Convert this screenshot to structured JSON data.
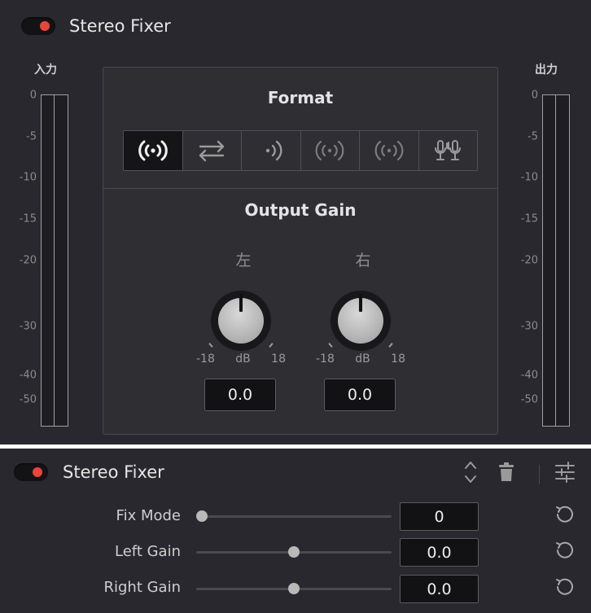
{
  "plugin": {
    "title": "Stereo Fixer",
    "enabled": true,
    "toggle_color": "#e8453c"
  },
  "input_meter": {
    "label": "入力",
    "ticks": [
      "0",
      "-5",
      "-10",
      "-15",
      "-20",
      "-30",
      "-40",
      "-50"
    ]
  },
  "output_meter": {
    "label": "出力",
    "ticks": [
      "0",
      "-5",
      "-10",
      "-15",
      "-20",
      "-30",
      "-40",
      "-50"
    ]
  },
  "format": {
    "title": "Format",
    "options": [
      {
        "icon": "stereo-broadcast-icon",
        "selected": true
      },
      {
        "icon": "swap-channels-icon",
        "selected": false
      },
      {
        "icon": "right-only-icon",
        "selected": false
      },
      {
        "icon": "mono-left-icon",
        "selected": false
      },
      {
        "icon": "mono-right-icon",
        "selected": false
      },
      {
        "icon": "dual-mic-icon",
        "selected": false
      }
    ]
  },
  "output_gain": {
    "title": "Output Gain",
    "left": {
      "label": "左",
      "min": "-18",
      "unit": "dB",
      "max": "18",
      "value": "0.0"
    },
    "right": {
      "label": "右",
      "min": "-18",
      "unit": "dB",
      "max": "18",
      "value": "0.0"
    }
  },
  "params": [
    {
      "label": "Fix Mode",
      "value": "0",
      "position": 0.0
    },
    {
      "label": "Left Gain",
      "value": "0.0",
      "position": 0.5
    },
    {
      "label": "Right Gain",
      "value": "0.0",
      "position": 0.5
    }
  ]
}
